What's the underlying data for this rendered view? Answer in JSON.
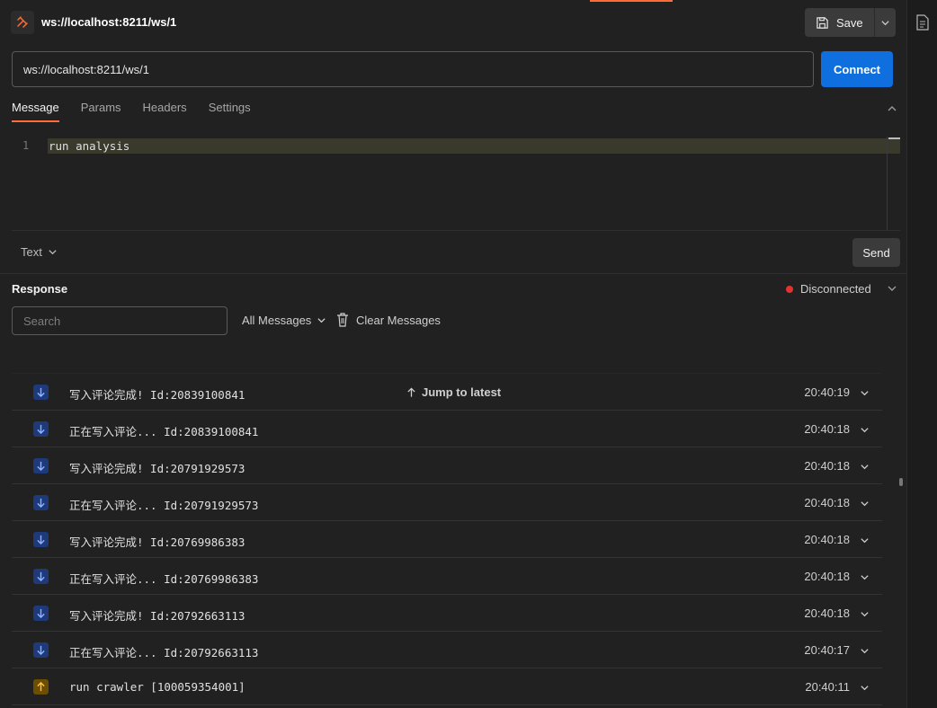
{
  "header": {
    "title": "ws://localhost:8211/ws/1",
    "save_label": "Save"
  },
  "url_bar": {
    "value": "ws://localhost:8211/ws/1",
    "connect_label": "Connect"
  },
  "tabs": [
    {
      "label": "Message",
      "active": true
    },
    {
      "label": "Params",
      "active": false
    },
    {
      "label": "Headers",
      "active": false
    },
    {
      "label": "Settings",
      "active": false
    }
  ],
  "editor": {
    "line_number": "1",
    "content": "run analysis"
  },
  "composer": {
    "format": "Text",
    "send_label": "Send"
  },
  "response": {
    "title": "Response",
    "status": "Disconnected",
    "status_color": "#e5322d",
    "search_placeholder": "Search",
    "filter": "All Messages",
    "clear_label": "Clear Messages",
    "jump_label": "Jump to latest",
    "messages": [
      {
        "direction": "in",
        "text": "写入评论完成! Id:20839100841",
        "time": "20:40:19"
      },
      {
        "direction": "in",
        "text": "正在写入评论... Id:20839100841",
        "time": "20:40:18"
      },
      {
        "direction": "in",
        "text": "写入评论完成! Id:20791929573",
        "time": "20:40:18"
      },
      {
        "direction": "in",
        "text": "正在写入评论... Id:20791929573",
        "time": "20:40:18"
      },
      {
        "direction": "in",
        "text": "写入评论完成! Id:20769986383",
        "time": "20:40:18"
      },
      {
        "direction": "in",
        "text": "正在写入评论... Id:20769986383",
        "time": "20:40:18"
      },
      {
        "direction": "in",
        "text": "写入评论完成! Id:20792663113",
        "time": "20:40:18"
      },
      {
        "direction": "in",
        "text": "正在写入评论... Id:20792663113",
        "time": "20:40:17"
      },
      {
        "direction": "out",
        "text": "run crawler [100059354001]",
        "time": "20:40:11"
      }
    ]
  },
  "colors": {
    "accent": "#ff6c37",
    "primary_button": "#0f6fde",
    "incoming": "#1e3a7a",
    "outgoing": "#6b4e00"
  }
}
